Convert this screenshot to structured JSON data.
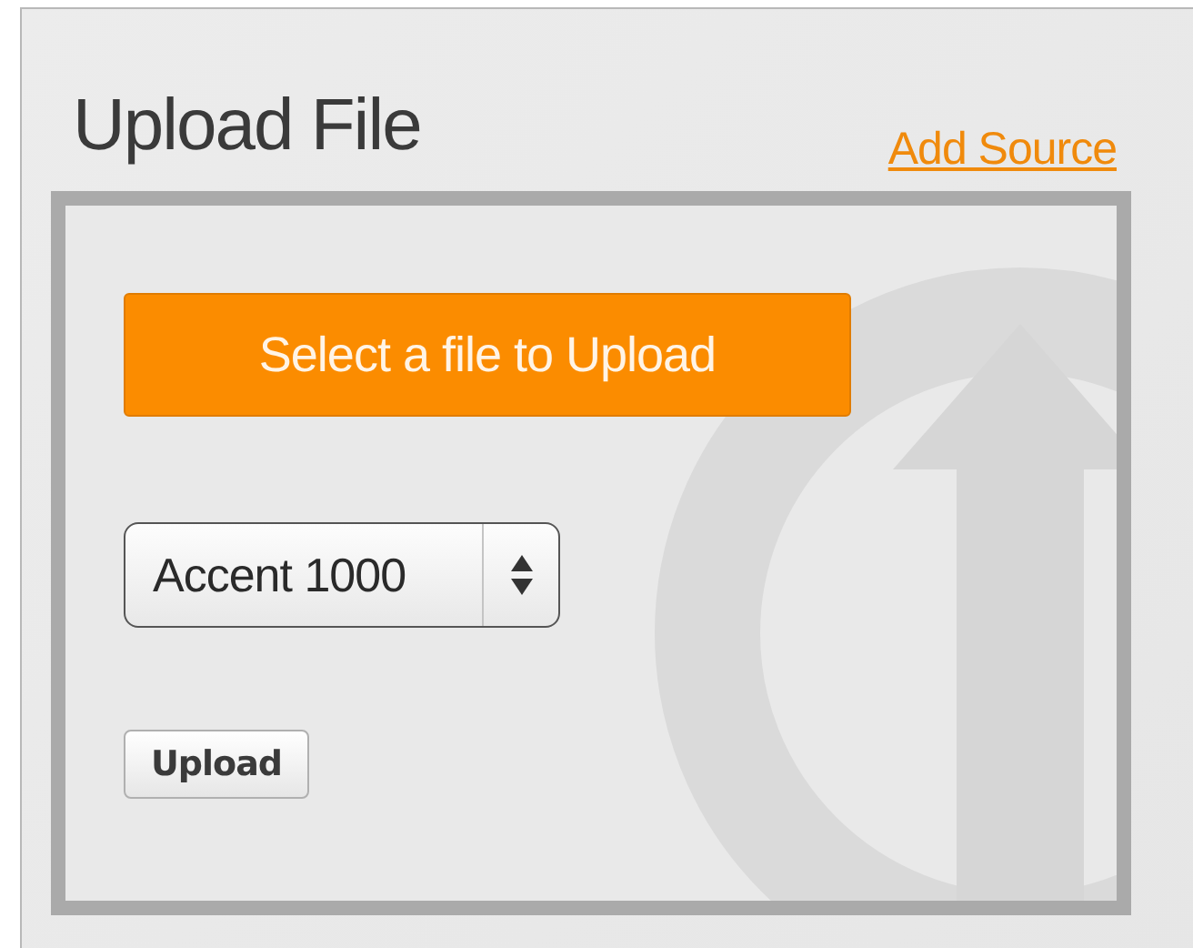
{
  "title": "Upload File",
  "add_source_link": "Add Source",
  "select_button": "Select a file to Upload",
  "source_select": {
    "value": "Accent 1000"
  },
  "upload_button": "Upload"
}
